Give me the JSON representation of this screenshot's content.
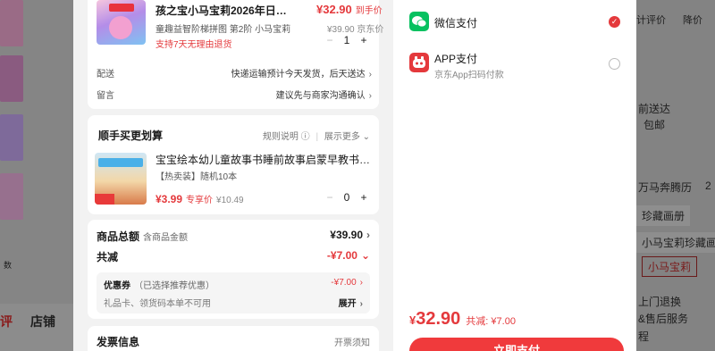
{
  "background": {
    "tabs": [
      "评",
      "店铺"
    ],
    "left_misc": "数",
    "right_top": [
      "计评价",
      "降价"
    ],
    "right_lines": [
      "前送达",
      "包邮",
      "万马奔腾历",
      "珍藏画册",
      "小马宝莉珍藏画册",
      "小马宝莉",
      "上门退换",
      "&售后服务",
      "程"
    ],
    "right_suffix": "2"
  },
  "product": {
    "title": "孩之宝小马宝莉2026年日历官...",
    "price": "¥32.90",
    "price_tag": "到手价",
    "spec": "童趣益智阶梯拼图 第2阶 小马宝莉",
    "original_price": "¥39.90 京东价",
    "return_policy": "支持7天无理由退货",
    "quantity": "1"
  },
  "delivery": {
    "label": "配送",
    "value": "快递运输预计今天发货，后天送达"
  },
  "note": {
    "label": "留言",
    "value": "建议先与商家沟通确认"
  },
  "addon": {
    "title": "顺手买更划算",
    "rules_link": "规则说明",
    "more_link": "展示更多",
    "book_title": "宝宝绘本幼儿童故事书睡前故事启蒙早教书籍 绘本0...",
    "book_spec": "【热卖装】随机10本",
    "book_price": "¥3.99",
    "book_price_tag": "专享价",
    "book_orig_price": "¥10.49",
    "quantity": "0"
  },
  "summary": {
    "goods_label": "商品总额",
    "goods_sub": "含商品金额",
    "goods_value": "¥39.90",
    "discount_label": "共减",
    "discount_value": "-¥7.00",
    "coupon_label": "优惠券",
    "coupon_hint": "（已选择推荐优惠）",
    "coupon_value": "-¥7.00",
    "gift_card_text": "礼品卡、领货码本单不可用",
    "expand": "展开"
  },
  "invoice": {
    "label": "发票信息",
    "hint": "开票须知"
  },
  "payment": {
    "options": [
      {
        "name": "微信支付",
        "sub": "",
        "icon": "wechat-icon",
        "color": "#07c160",
        "selected": true
      },
      {
        "name": "APP支付",
        "sub": "京东App扫码付款",
        "icon": "jd-app-icon",
        "color": "#e4393c",
        "selected": false
      }
    ],
    "total_currency": "¥",
    "total_amount": "32.90",
    "total_discount": "共减: ¥7.00",
    "pay_button": "立即支付"
  },
  "colors": {
    "accent": "#e4393c",
    "wechat": "#07c160"
  }
}
